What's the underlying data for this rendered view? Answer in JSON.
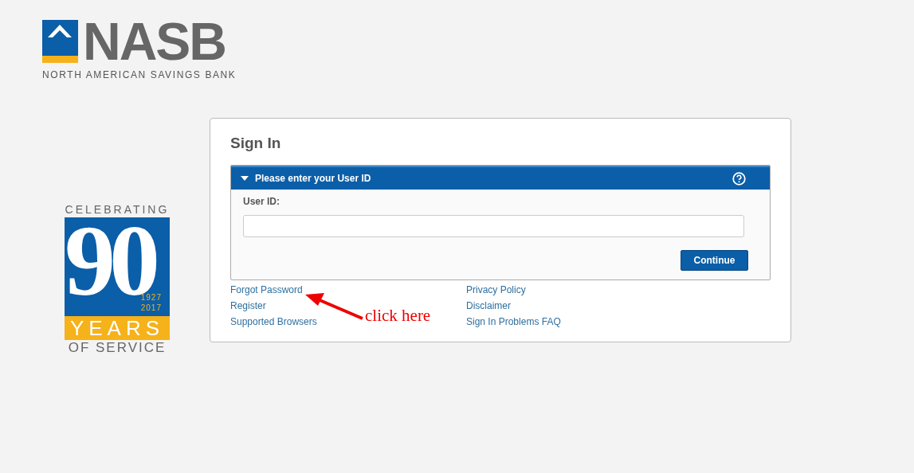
{
  "logo": {
    "wordmark": "NASB",
    "tagline": "NORTH AMERICAN SAVINGS BANK"
  },
  "anniversary": {
    "top": "CELEBRATING",
    "number": "90",
    "years_range": [
      "1927",
      "2017"
    ],
    "years": "YEARS",
    "bottom": "OF SERVICE"
  },
  "sign_in": {
    "title": "Sign In",
    "panel": {
      "title": "Please enter your User ID",
      "expanded": true,
      "field_label": "User ID:",
      "button": "Continue"
    },
    "links_left": [
      "Forgot Password",
      "Register",
      "Supported Browsers"
    ],
    "links_right": [
      "Privacy Policy",
      "Disclaimer",
      "Sign In Problems FAQ"
    ]
  },
  "annotation": {
    "text": "click here"
  }
}
